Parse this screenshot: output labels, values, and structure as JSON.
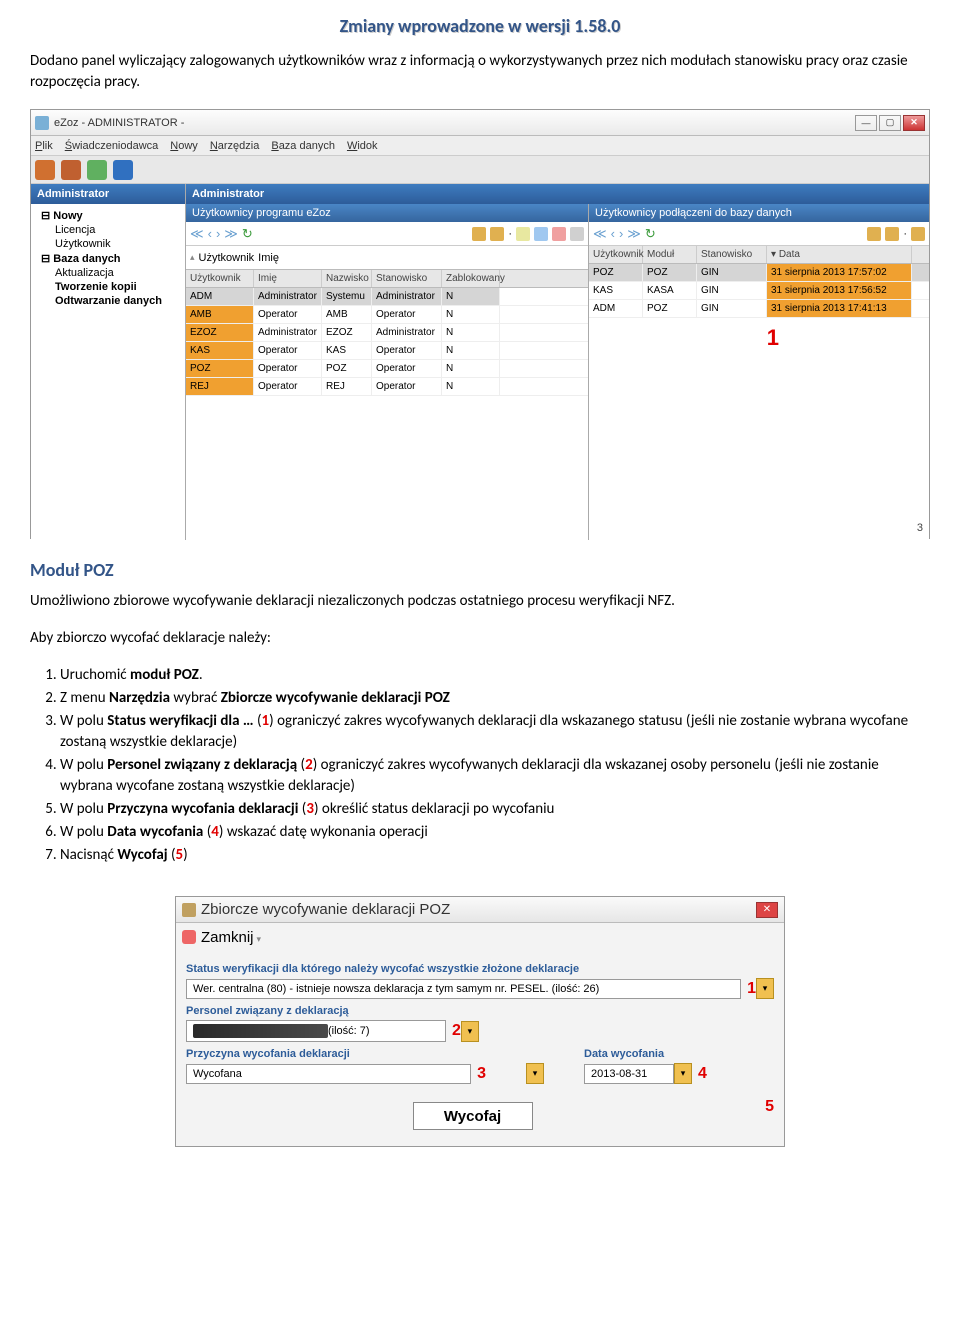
{
  "title": "Zmiany wprowadzone w wersji 1.58.0",
  "paragraph1": "Dodano panel wyliczający zalogowanych użytkowników wraz z informacją o wykorzystywanych przez nich modułach stanowisku pracy oraz czasie rozpoczęcia pracy.",
  "modul_title": "Moduł POZ",
  "paragraph2": "Umożliwiono zbiorowe wycofywanie deklaracji niezaliczonych podczas ostatniego procesu weryfikacji NFZ.",
  "paragraph3": "Aby zbiorczo wycofać deklaracje należy:",
  "list": [
    {
      "pre": "Uruchomić ",
      "b1": "moduł POZ",
      "post1": "."
    },
    {
      "pre": "Z menu ",
      "b1": "Narzędzia",
      "mid": " wybrać ",
      "b2": "Zbiorcze wycofywanie deklaracji POZ",
      "post": ""
    },
    {
      "pre": "W polu ",
      "b1": "Status weryfikacji dla …",
      "mid": " (",
      "n": "1",
      "post": ") ograniczyć zakres wycofywanych deklaracji dla wskazanego statusu (jeśli nie zostanie wybrana wycofane zostaną wszystkie deklaracje)"
    },
    {
      "pre": "W polu ",
      "b1": "Personel związany z deklaracją",
      "mid": " (",
      "n": "2",
      "post": ") ograniczyć zakres wycofywanych deklaracji dla wskazanej osoby personelu (jeśli nie zostanie wybrana wycofane zostaną wszystkie deklaracje)"
    },
    {
      "pre": "W polu ",
      "b1": "Przyczyna wycofania deklaracji",
      "mid": " (",
      "n": "3",
      "post": ") określić status deklaracji po wycofaniu"
    },
    {
      "pre": "W polu ",
      "b1": "Data wycofania",
      "mid": " (",
      "n": "4",
      "post": ") wskazać datę wykonania operacji"
    },
    {
      "pre": "Nacisnąć ",
      "b1": "Wycofaj",
      "mid": " (",
      "n": "5",
      "post": ")"
    }
  ],
  "scr1": {
    "win_title": "eZoz - ADMINISTRATOR -",
    "menus": [
      "Plik",
      "Świadczeniodawca",
      "Nowy",
      "Narzędzia",
      "Baza danych",
      "Widok"
    ],
    "tree_title": "Administrator",
    "tree": [
      {
        "label": "Nowy",
        "cls": "parent bold"
      },
      {
        "label": "Licencja",
        "cls": "child"
      },
      {
        "label": "Użytkownik",
        "cls": "child"
      },
      {
        "label": "Baza danych",
        "cls": "parent bold"
      },
      {
        "label": "Aktualizacja",
        "cls": "child"
      },
      {
        "label": "Tworzenie kopii",
        "cls": "child bold"
      },
      {
        "label": "Odtwarzanie danych",
        "cls": "child bold"
      }
    ],
    "main_title": "Administrator",
    "sub_left": "Użytkownicy programu eZoz",
    "sub_right": "Użytkownicy podłączeni do bazy danych",
    "users_headers": [
      "Użytkownik",
      "Imię",
      "Nazwisko",
      "Stanowisko",
      "Zablokowany"
    ],
    "users": [
      [
        "ADM",
        "Administrator",
        "Systemu",
        "Administrator",
        "N"
      ],
      [
        "AMB",
        "Operator",
        "AMB",
        "Operator",
        "N"
      ],
      [
        "EZOZ",
        "Administrator",
        "EZOZ",
        "Administrator",
        "N"
      ],
      [
        "KAS",
        "Operator",
        "KAS",
        "Operator",
        "N"
      ],
      [
        "POZ",
        "Operator",
        "POZ",
        "Operator",
        "N"
      ],
      [
        "REJ",
        "Operator",
        "REJ",
        "Operator",
        "N"
      ]
    ],
    "conn_headers": [
      "Użytkownik",
      "Moduł",
      "Stanowisko",
      "Data"
    ],
    "conn": [
      [
        "POZ",
        "POZ",
        "GIN",
        "31 sierpnia 2013 17:57:02"
      ],
      [
        "KAS",
        "KASA",
        "GIN",
        "31 sierpnia 2013 17:56:52"
      ],
      [
        "ADM",
        "POZ",
        "GIN",
        "31 sierpnia 2013 17:41:13"
      ]
    ],
    "annot": "1",
    "count": "3"
  },
  "scr2": {
    "title": "Zbiorcze wycofywanie deklaracji POZ",
    "zamknij": "Zamknij",
    "label_status": "Status weryfikacji dla którego należy wycofać wszystkie złożone deklaracje",
    "status_val": "Wer. centralna (80) - istnieje nowsza deklaracja z tym samym nr. PESEL. (ilość: 26)",
    "label_personel": "Personel związany z deklaracją",
    "personel_suffix": " (ilość: 7)",
    "label_przyczyna": "Przyczyna wycofania deklaracji",
    "przyczyna_val": "Wycofana",
    "label_data": "Data wycofania",
    "data_val": "2013-08-31",
    "btn": "Wycofaj",
    "a1": "1",
    "a2": "2",
    "a3": "3",
    "a4": "4",
    "a5": "5"
  }
}
